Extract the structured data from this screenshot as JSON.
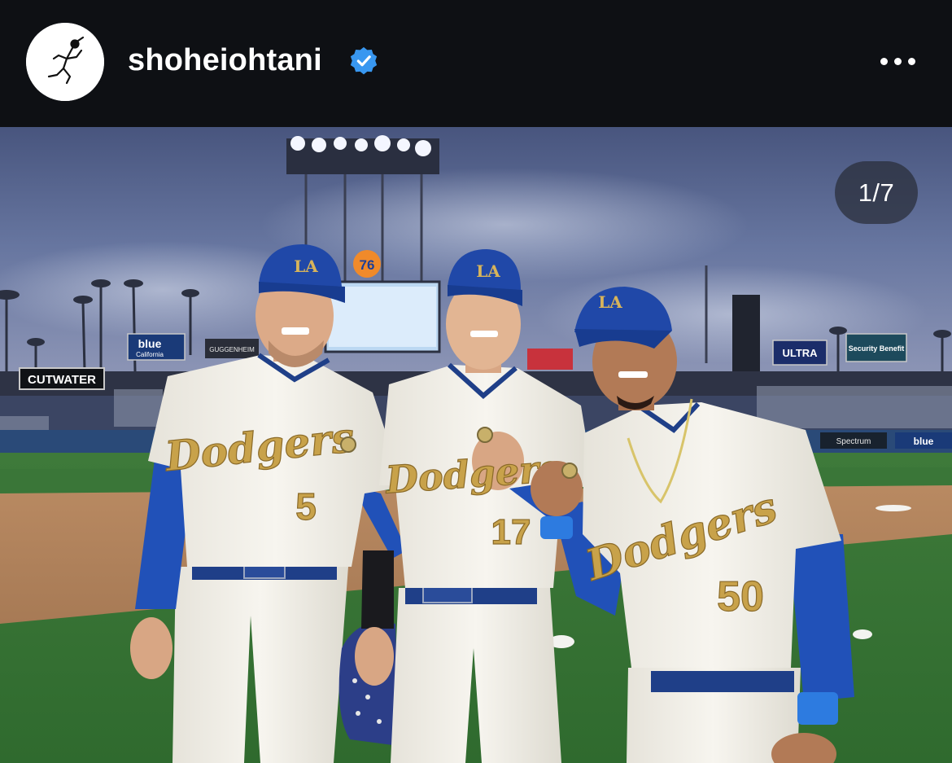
{
  "post": {
    "username": "shoheiohtani",
    "verified": true,
    "avatar_icon": "running-player-logo",
    "more_icon": "more-horizontal-icon",
    "accent_color": "#3897f0"
  },
  "media": {
    "page_indicator": "1/7",
    "current_index": 1,
    "total": 7,
    "description_colors": {
      "sky": "#5f6f9a",
      "jersey": "#f3f1ea",
      "cap": "#1f4fa6",
      "gold": "#c8a24a"
    },
    "scene_text": {
      "board_cutwater": "CUTWATER",
      "board_blue": "blue",
      "board_blue_sub": "California",
      "board_guggenheim": "GUGGENHEIM",
      "board_ultra": "ULTRA",
      "board_security": "Security Benefit",
      "board_spectrum": "Spectrum",
      "board_blue_right": "blue",
      "sign_76": "76",
      "cap_logo": "LA",
      "jersey_wordmark": "Dodgers",
      "player_left_number": "5",
      "player_center_number": "17",
      "player_right_number": "50"
    }
  }
}
